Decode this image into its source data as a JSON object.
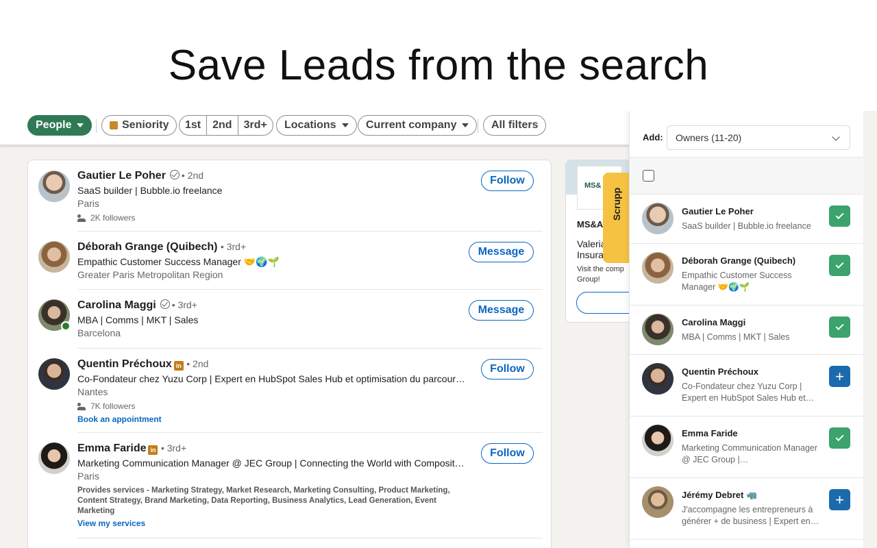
{
  "hero": {
    "title": "Save Leads from the search"
  },
  "filters": {
    "people": "People",
    "seniority": "Seniority",
    "degrees": [
      "1st",
      "2nd",
      "3rd+"
    ],
    "locations": "Locations",
    "current_company": "Current company",
    "all_filters": "All filters"
  },
  "results": [
    {
      "name": "Gautier Le Poher",
      "degree": "• 2nd",
      "headline": "SaaS builder | Bubble.io freelance",
      "location": "Paris",
      "followers": "2K followers",
      "action": "Follow"
    },
    {
      "name": "Déborah Grange (Quibech)",
      "degree": "• 3rd+",
      "headline": "Empathic Customer Success Manager 🤝🌍🌱",
      "location": "Greater Paris Metropolitan Region",
      "action": "Message"
    },
    {
      "name": "Carolina Maggi",
      "degree": "• 3rd+",
      "headline": "MBA | Comms | MKT | Sales",
      "location": "Barcelona",
      "action": "Message"
    },
    {
      "name": "Quentin Préchoux",
      "degree": "• 2nd",
      "headline": "Co-Fondateur chez Yuzu Corp | Expert en HubSpot Sales Hub et optimisation du parcours…",
      "location": "Nantes",
      "followers": "7K followers",
      "link": "Book an appointment",
      "action": "Follow"
    },
    {
      "name": "Emma Faride",
      "degree": "• 3rd+",
      "headline": "Marketing Communication Manager @ JEC Group | Connecting the World with Composites …",
      "location": "Paris",
      "services": "Provides services - Marketing Strategy, Market Research, Marketing Consulting, Product Marketing, Content Strategy, Brand Marketing, Data Reporting, Business Analytics, Lead Generation, Event Marketing",
      "link": "View my services",
      "action": "Follow"
    }
  ],
  "side_card": {
    "logo_text": "MS&",
    "company": "MS&A",
    "person": "Valeria\nInsura",
    "desc": "Visit the comp\nGroup!"
  },
  "scrupp_tab": {
    "label": "Scrupp"
  },
  "panel": {
    "add_label": "Add:",
    "select_value": "Owners (11-20)",
    "leads": [
      {
        "name": "Gautier Le Poher",
        "headline": "SaaS builder | Bubble.io freelance",
        "status": "saved"
      },
      {
        "name": "Déborah Grange (Quibech)",
        "headline": "Empathic Customer Success Manager 🤝🌍🌱",
        "status": "saved"
      },
      {
        "name": "Carolina Maggi",
        "headline": "MBA | Comms | MKT | Sales",
        "status": "saved"
      },
      {
        "name": "Quentin Préchoux",
        "headline": "Co-Fondateur chez Yuzu Corp | Expert en HubSpot Sales Hub et…",
        "status": "add"
      },
      {
        "name": "Emma Faride",
        "headline": "Marketing Communication Manager @ JEC Group |…",
        "status": "saved"
      },
      {
        "name": "Jérémy Debret 🦏",
        "headline": "J'accompagne les entrepreneurs à générer + de business | Expert en…",
        "status": "add"
      }
    ]
  },
  "colors": {
    "accent_green": "#2f7a55",
    "link_blue": "#0a66c2",
    "saved_green": "#3ba36b",
    "add_blue": "#1b6aac",
    "scrupp_yellow": "#f5c242"
  }
}
